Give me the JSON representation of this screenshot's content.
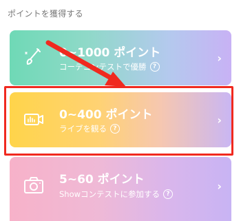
{
  "section": {
    "title": "ポイントを獲得する"
  },
  "cards": [
    {
      "title": "0~1000 ポイント",
      "subtitle": "コーデコンテストで優勝",
      "icon": "paintbrush-icon",
      "help": "?",
      "chevron": "›"
    },
    {
      "title": "0~400 ポイント",
      "subtitle": "ライブを観る",
      "icon": "live-video-icon",
      "help": "?",
      "chevron": "›"
    },
    {
      "title": "5~60 ポイント",
      "subtitle": "Showコンテストに参加する",
      "icon": "camera-icon",
      "help": "?",
      "chevron": "›"
    }
  ],
  "annotation": {
    "highlight_color": "#f0291f"
  }
}
